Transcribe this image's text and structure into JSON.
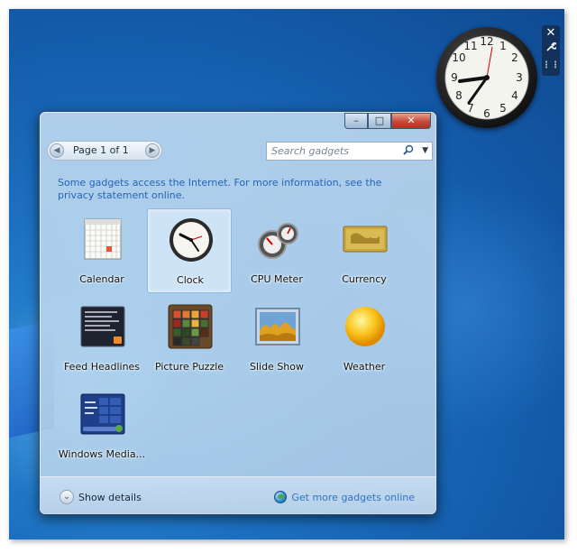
{
  "window": {
    "caption": {
      "minimize": "–",
      "maximize": "□",
      "close": "✕"
    },
    "pager": {
      "prev": "◀",
      "label": "Page 1 of 1",
      "next": "▶"
    },
    "search": {
      "placeholder": "Search gadgets",
      "dropdown": "▼"
    },
    "info_text": "Some gadgets access the Internet.  For more information, see the privacy statement online.",
    "gadgets": [
      {
        "label": "Calendar",
        "icon": "calendar-icon"
      },
      {
        "label": "Clock",
        "icon": "clock-icon",
        "selected": true
      },
      {
        "label": "CPU Meter",
        "icon": "cpu-meter-icon"
      },
      {
        "label": "Currency",
        "icon": "currency-icon"
      },
      {
        "label": "Feed Headlines",
        "icon": "feed-headlines-icon"
      },
      {
        "label": "Picture Puzzle",
        "icon": "picture-puzzle-icon"
      },
      {
        "label": "Slide Show",
        "icon": "slide-show-icon"
      },
      {
        "label": "Weather",
        "icon": "weather-icon"
      },
      {
        "label": "Windows Media...",
        "icon": "windows-media-icon"
      }
    ],
    "footer": {
      "show_details": "Show details",
      "show_details_chevron": "⌄",
      "get_more": "Get more gadgets online"
    }
  },
  "desktop_gadget": {
    "clock_numbers": [
      "12",
      "1",
      "2",
      "3",
      "4",
      "5",
      "6",
      "7",
      "8",
      "9",
      "10",
      "11"
    ],
    "toolbar": {
      "close": "✕",
      "options": "🔧",
      "drag": "⋮⋮"
    }
  },
  "colors": {
    "desktop": "#1c6fc0",
    "link": "#2565b5",
    "close_button": "#c44a36"
  }
}
